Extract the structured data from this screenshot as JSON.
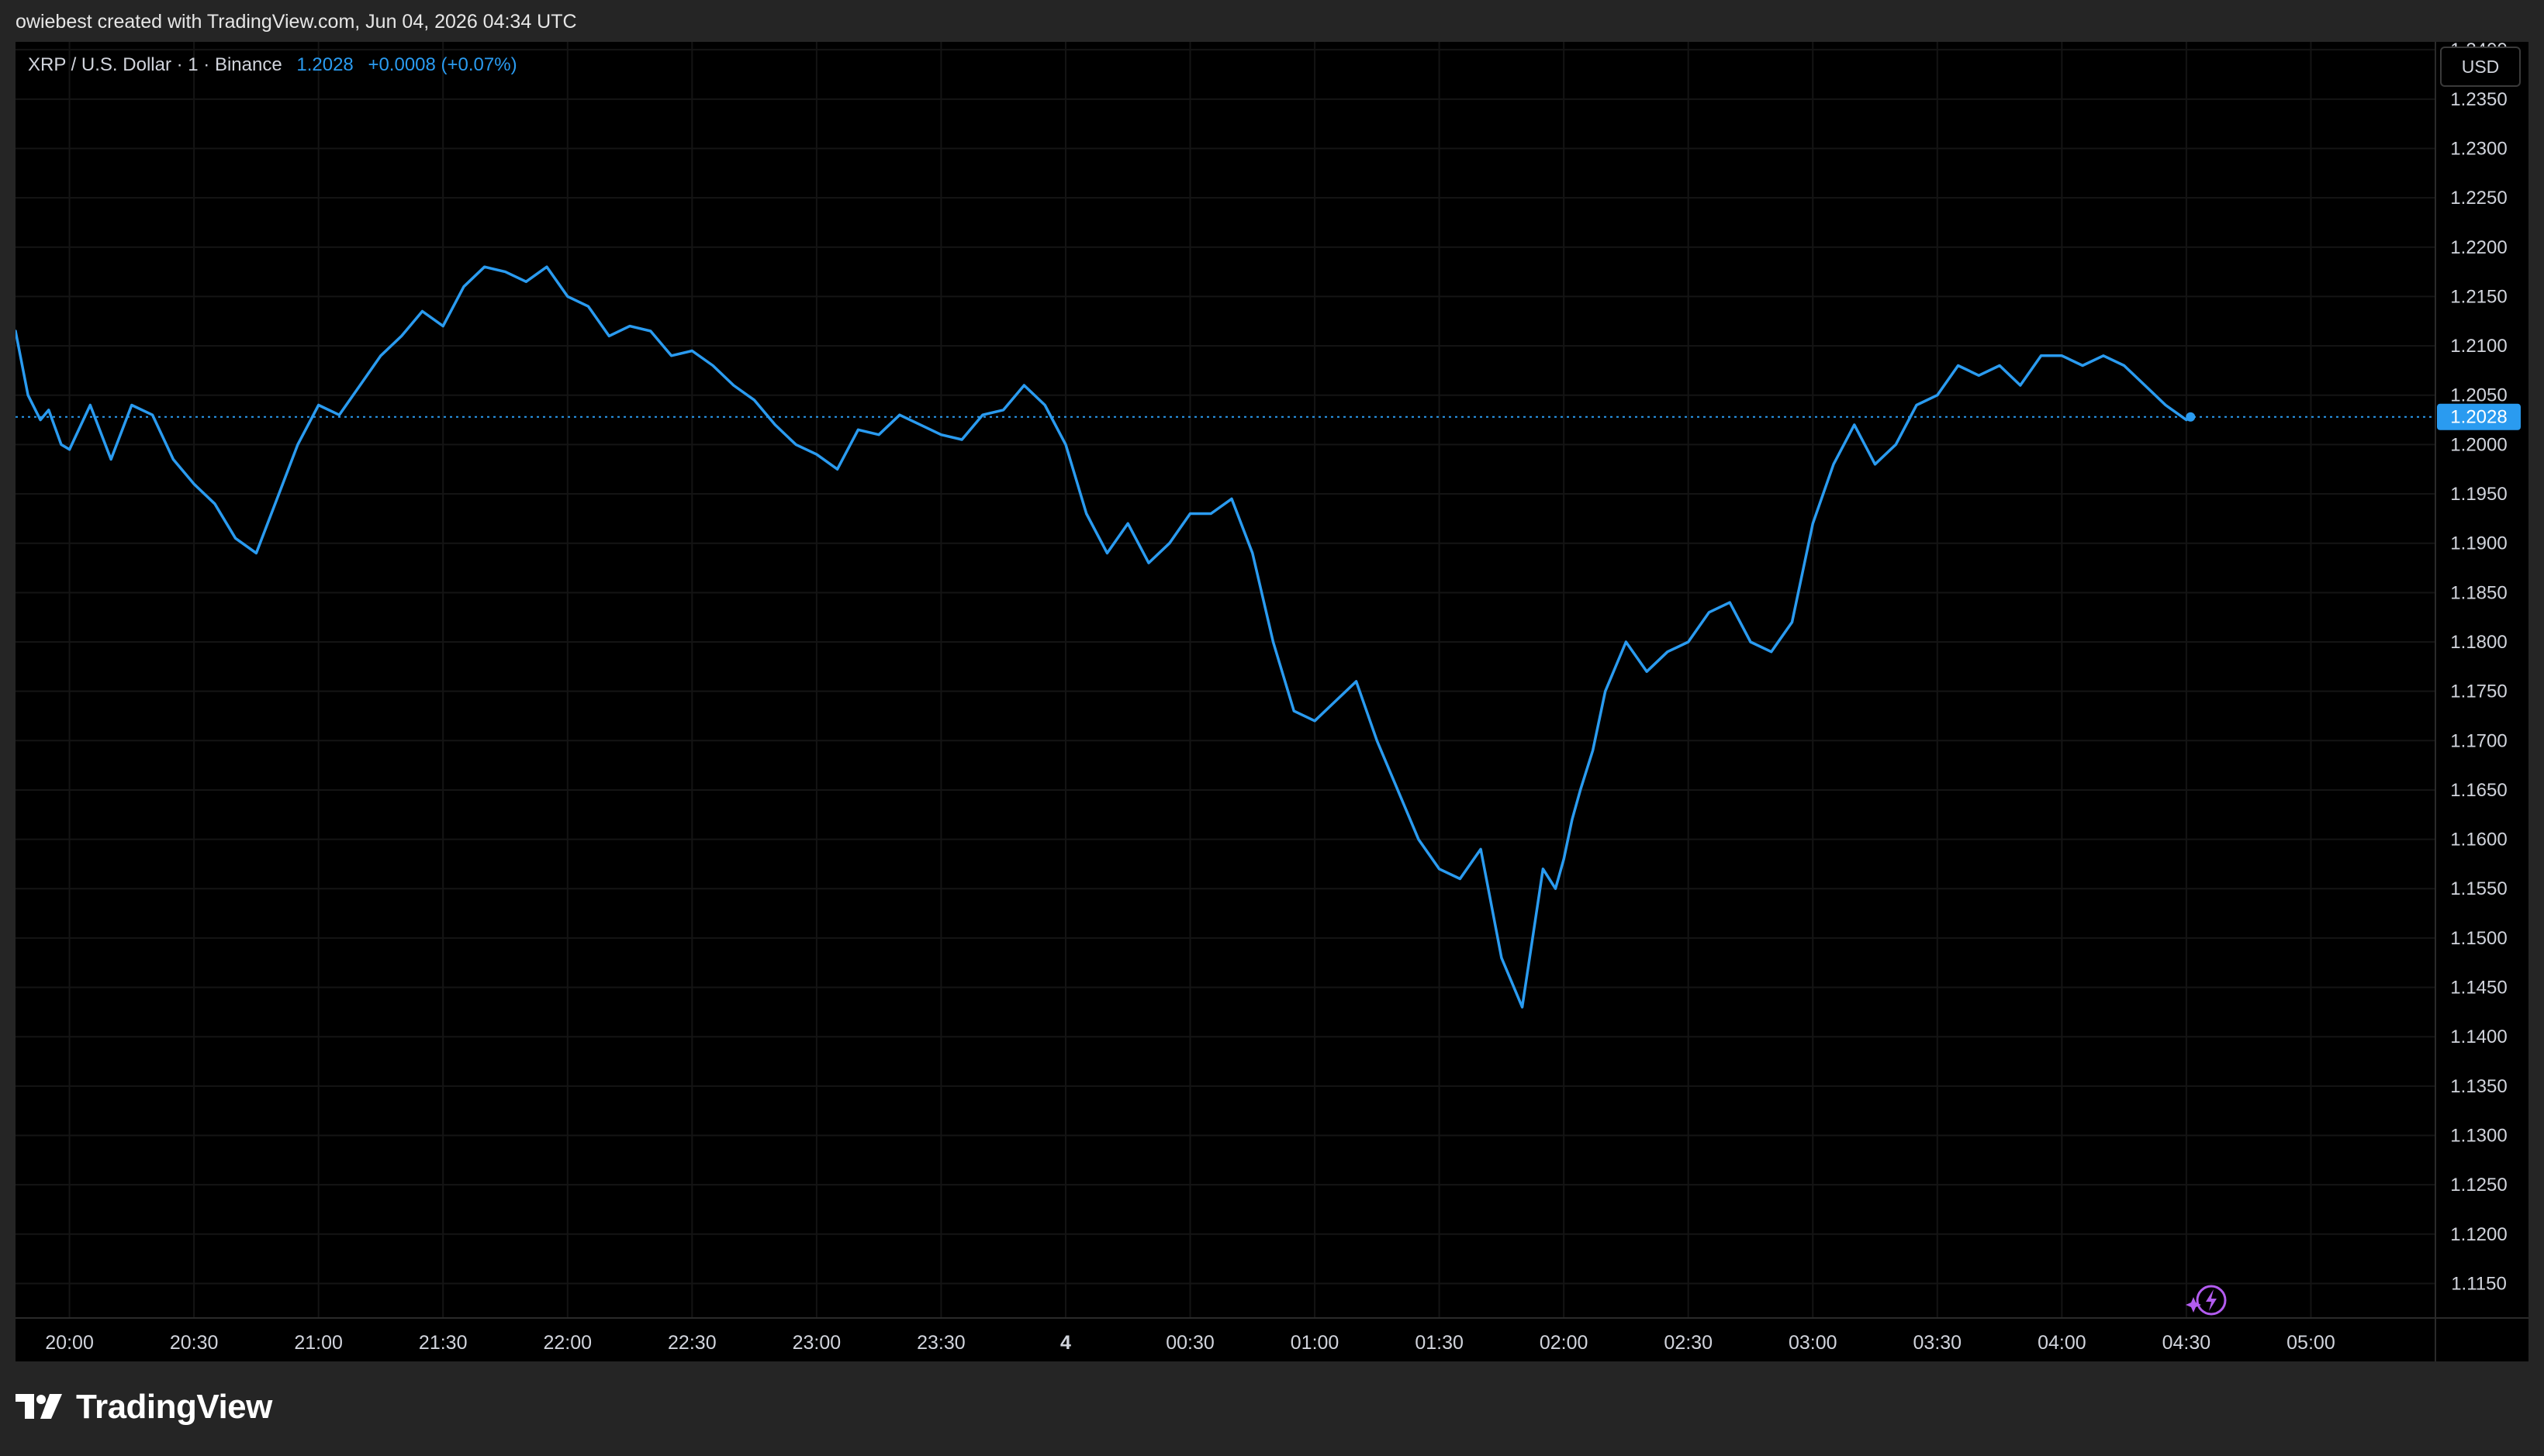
{
  "attribution": "owiebest created with TradingView.com, Jun 04, 2026 04:34 UTC",
  "legend": {
    "symbol": "XRP / U.S. Dollar · 1 · Binance",
    "price": "1.2028",
    "change": "+0.0008 (+0.07%)"
  },
  "currency_label": "USD",
  "brand": {
    "name": "TradingView",
    "icon": "tradingview-logo-icon"
  },
  "colors": {
    "line": "#2a9bf0",
    "background": "#000000",
    "grid": "#141414",
    "axis_text": "#d1d4dc",
    "price_label_bg": "#2a9bf0",
    "flash_icon": "#b35cf0"
  },
  "chart_data": {
    "type": "line",
    "title": "XRP / U.S. Dollar · 1 · Binance",
    "xlabel": "",
    "ylabel": "",
    "x_ticks": [
      "20:00",
      "20:30",
      "21:00",
      "21:30",
      "22:00",
      "22:30",
      "23:00",
      "23:30",
      "4",
      "00:30",
      "01:00",
      "01:30",
      "02:00",
      "02:30",
      "03:00",
      "03:30",
      "04:00",
      "04:30",
      "05:00"
    ],
    "y_ticks": [
      "1.1150",
      "1.1200",
      "1.1250",
      "1.1300",
      "1.1350",
      "1.1400",
      "1.1450",
      "1.1500",
      "1.1550",
      "1.1600",
      "1.1650",
      "1.1700",
      "1.1750",
      "1.1800",
      "1.1850",
      "1.1900",
      "1.1950",
      "1.2000",
      "1.2050",
      "1.2100",
      "1.2150",
      "1.2200",
      "1.2250",
      "1.2300",
      "1.2350",
      "1.2400"
    ],
    "ylim": [
      1.1115,
      1.2408
    ],
    "xlim": [
      "19:47",
      "05:30"
    ],
    "grid": true,
    "last_price": 1.2028,
    "series": [
      {
        "values_time": [
          "19:47",
          "19:50",
          "19:53",
          "19:55",
          "19:58",
          "20:00",
          "20:05",
          "20:10",
          "20:15",
          "20:20",
          "20:25",
          "20:30",
          "20:35",
          "20:40",
          "20:45",
          "20:50",
          "20:55",
          "21:00",
          "21:05",
          "21:10",
          "21:15",
          "21:20",
          "21:25",
          "21:30",
          "21:35",
          "21:40",
          "21:45",
          "21:50",
          "21:55",
          "22:00",
          "22:05",
          "22:10",
          "22:15",
          "22:20",
          "22:25",
          "22:30",
          "22:35",
          "22:40",
          "22:45",
          "22:50",
          "22:55",
          "23:00",
          "23:05",
          "23:10",
          "23:15",
          "23:20",
          "23:25",
          "23:30",
          "23:35",
          "23:40",
          "23:45",
          "23:50",
          "23:55",
          "00:00",
          "00:05",
          "00:10",
          "00:15",
          "00:20",
          "00:25",
          "00:30",
          "00:35",
          "00:40",
          "00:45",
          "00:50",
          "00:55",
          "01:00",
          "01:05",
          "01:10",
          "01:15",
          "01:20",
          "01:25",
          "01:30",
          "01:35",
          "01:40",
          "01:45",
          "01:50",
          "01:55",
          "01:58",
          "02:00",
          "02:02",
          "02:04",
          "02:07",
          "02:10",
          "02:15",
          "02:20",
          "02:25",
          "02:30",
          "02:35",
          "02:40",
          "02:45",
          "02:50",
          "02:55",
          "03:00",
          "03:05",
          "03:10",
          "03:15",
          "03:20",
          "03:25",
          "03:30",
          "03:35",
          "03:40",
          "03:45",
          "03:50",
          "03:55",
          "04:00",
          "04:05",
          "04:10",
          "04:15",
          "04:20",
          "04:25",
          "04:30",
          "04:31"
        ],
        "values": [
          1.2115,
          1.205,
          1.2025,
          1.2035,
          1.2,
          1.1995,
          1.204,
          1.1985,
          1.204,
          1.203,
          1.1985,
          1.196,
          1.194,
          1.1905,
          1.189,
          1.1945,
          1.2,
          1.204,
          1.203,
          1.206,
          1.209,
          1.211,
          1.2135,
          1.212,
          1.216,
          1.218,
          1.2175,
          1.2165,
          1.218,
          1.215,
          1.214,
          1.211,
          1.212,
          1.2115,
          1.209,
          1.2095,
          1.208,
          1.206,
          1.2045,
          1.202,
          1.2,
          1.199,
          1.1975,
          1.2015,
          1.201,
          1.203,
          1.202,
          1.201,
          1.2005,
          1.203,
          1.2035,
          1.206,
          1.204,
          1.2,
          1.193,
          1.189,
          1.192,
          1.188,
          1.19,
          1.193,
          1.193,
          1.1945,
          1.189,
          1.18,
          1.173,
          1.172,
          1.174,
          1.176,
          1.17,
          1.165,
          1.16,
          1.157,
          1.156,
          1.159,
          1.148,
          1.143,
          1.157,
          1.155,
          1.158,
          1.162,
          1.165,
          1.169,
          1.175,
          1.18,
          1.177,
          1.179,
          1.18,
          1.183,
          1.184,
          1.18,
          1.179,
          1.182,
          1.192,
          1.198,
          1.202,
          1.198,
          1.2,
          1.204,
          1.205,
          1.208,
          1.207,
          1.208,
          1.206,
          1.209,
          1.209,
          1.208,
          1.209,
          1.208,
          1.206,
          1.204,
          1.2025,
          1.2028
        ]
      }
    ]
  }
}
